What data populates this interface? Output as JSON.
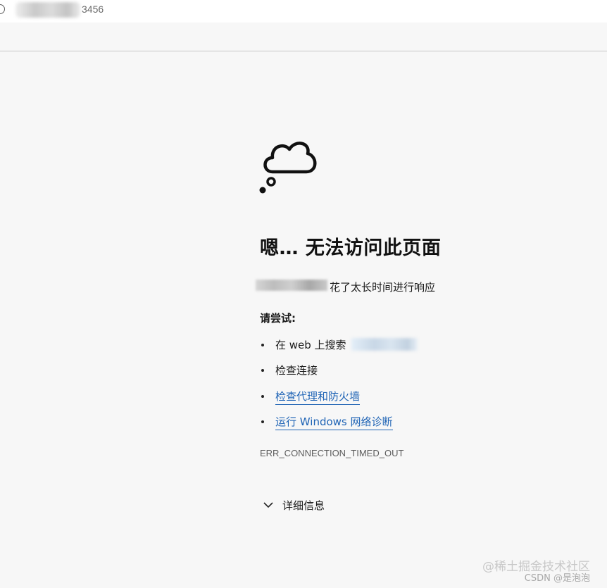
{
  "address_bar": {
    "url_visible_suffix": "3456"
  },
  "page": {
    "title": "嗯… 无法访问此页面",
    "timeout_message": "花了太长时间进行响应",
    "try_heading": "请尝试:",
    "suggestions": [
      {
        "label": "在 web 上搜索",
        "is_link": false
      },
      {
        "label": "检查连接",
        "is_link": false
      },
      {
        "label": "检查代理和防火墙",
        "is_link": true
      },
      {
        "label": "运行 Windows 网络诊断",
        "is_link": true
      }
    ],
    "error_code": "ERR_CONNECTION_TIMED_OUT",
    "details_label": "详细信息"
  },
  "watermark": {
    "line1": "@稀土掘金技术社区",
    "line2": "CSDN @是泡泡"
  },
  "colors": {
    "background": "#f7f7f7",
    "link": "#1e63b5",
    "text": "#1a1a1a",
    "error_code": "#5c5c5c"
  },
  "icons": {
    "illustration": "thought-cloud-icon",
    "details_toggle": "chevron-down-icon",
    "site_info": "info-icon"
  }
}
